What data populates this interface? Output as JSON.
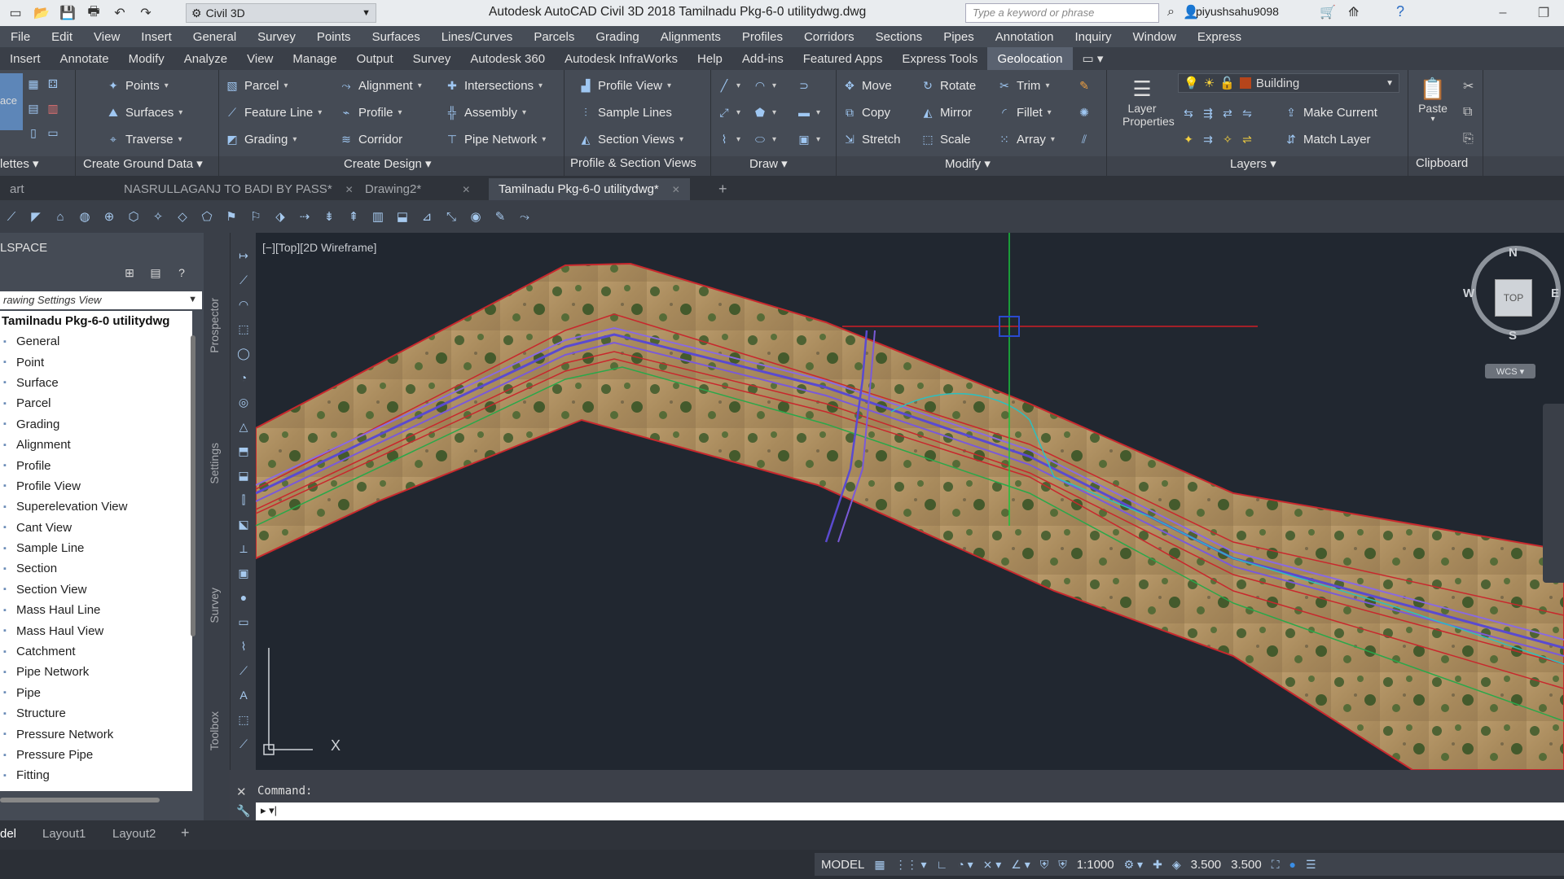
{
  "workspace": {
    "name": "Civil 3D"
  },
  "title_bar": {
    "title": "Autodesk AutoCAD Civil 3D 2018    Tamilnadu Pkg-6-0 utilitydwg.dwg",
    "search_placeholder": "Type a keyword or phrase",
    "user": "piyushsahu9098",
    "win_min": "–",
    "win_max": "❐",
    "win_close": "✕"
  },
  "menu_bar": [
    "File",
    "Edit",
    "View",
    "Insert",
    "General",
    "Survey",
    "Points",
    "Surfaces",
    "Lines/Curves",
    "Parcels",
    "Grading",
    "Alignments",
    "Profiles",
    "Corridors",
    "Sections",
    "Pipes",
    "Annotation",
    "Inquiry",
    "Window",
    "Express"
  ],
  "ribbon_tabs": [
    "Insert",
    "Annotate",
    "Modify",
    "Analyze",
    "View",
    "Manage",
    "Output",
    "Survey",
    "Autodesk 360",
    "Autodesk InfraWorks",
    "Help",
    "Add-ins",
    "Featured Apps",
    "Express Tools",
    "Geolocation"
  ],
  "ribbon_active_tab": "Geolocation",
  "ribbon": {
    "ground": {
      "points": "Points",
      "surfaces": "Surfaces",
      "traverse": "Traverse",
      "title": "Create Ground Data"
    },
    "design": {
      "parcel": "Parcel",
      "feature_line": "Feature Line",
      "grading": "Grading",
      "alignment": "Alignment",
      "profile": "Profile",
      "corridor": "Corridor",
      "intersections": "Intersections",
      "assembly": "Assembly",
      "pipe_network": "Pipe Network",
      "title": "Create Design"
    },
    "profile_section": {
      "profile_view": "Profile View",
      "sample_lines": "Sample Lines",
      "section_views": "Section Views",
      "title": "Profile & Section Views"
    },
    "draw": {
      "title": "Draw"
    },
    "modify": {
      "move": "Move",
      "copy": "Copy",
      "stretch": "Stretch",
      "rotate": "Rotate",
      "mirror": "Mirror",
      "scale": "Scale",
      "trim": "Trim",
      "fillet": "Fillet",
      "array": "Array",
      "title": "Modify"
    },
    "layers": {
      "current_layer": "Building",
      "layer_properties_1": "Layer",
      "layer_properties_2": "Properties",
      "make_current": "Make Current",
      "match_layer": "Match Layer",
      "title": "Layers"
    },
    "clipboard": {
      "paste": "Paste",
      "title": "Clipboard"
    },
    "palettes": {
      "title": "lettes",
      "left_label": "ace"
    }
  },
  "doc_tabs": {
    "start": "art",
    "tab1": "NASRULLAGANJ TO BADI BY PASS*",
    "tab2": "Drawing2*",
    "tab3": "Tamilnadu Pkg-6-0 utilitydwg*",
    "new": "+"
  },
  "toolspace": {
    "title": "LSPACE",
    "view": "rawing Settings View",
    "root": "Tamilnadu Pkg-6-0 utilitydwg",
    "items": [
      "General",
      "Point",
      "Surface",
      "Parcel",
      "Grading",
      "Alignment",
      "Profile",
      "Profile View",
      "Superelevation View",
      "Cant View",
      "Sample Line",
      "Section",
      "Section View",
      "Mass Haul Line",
      "Mass Haul View",
      "Catchment",
      "Pipe Network",
      "Pipe",
      "Structure",
      "Pressure Network",
      "Pressure Pipe",
      "Fitting"
    ]
  },
  "side_tabs": {
    "prospector": "Prospector",
    "settings": "Settings",
    "survey": "Survey",
    "toolbox": "Toolbox"
  },
  "viewport": {
    "label": "[−][Top][2D Wireframe]",
    "compass": {
      "n": "N",
      "s": "S",
      "e": "E",
      "w": "W",
      "top": "TOP"
    },
    "wcs": "WCS ▾",
    "ucs_x": "X"
  },
  "command": {
    "history": "Command:",
    "prompt": "▸ ▾|"
  },
  "layout_tabs": {
    "model": "del",
    "layout1": "Layout1",
    "layout2": "Layout2",
    "add": "+"
  },
  "status_bar": {
    "model": "MODEL",
    "scale": "1:1000",
    "value1": "3.500",
    "value2": "3.500"
  },
  "colors": {
    "viewport_bg": "#212730",
    "boundary": "#c8282d",
    "alignment": "#5a4ad0",
    "crosshair_h": "#d01f25",
    "crosshair_v": "#19c43a"
  }
}
